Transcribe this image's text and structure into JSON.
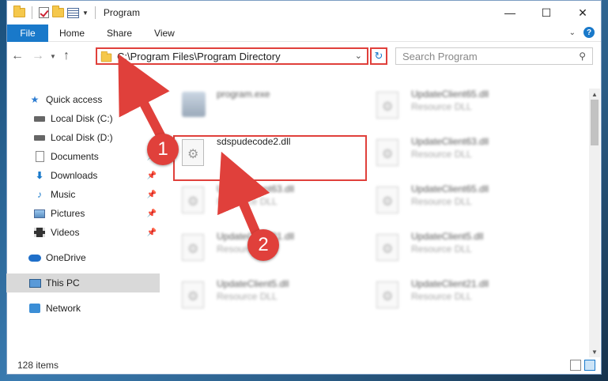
{
  "window": {
    "title": "Program"
  },
  "ribbon": {
    "file": "File",
    "tabs": [
      "Home",
      "Share",
      "View"
    ],
    "help": "?"
  },
  "address": {
    "path": "C:\\Program Files\\Program Directory"
  },
  "search": {
    "placeholder": "Search Program"
  },
  "sidebar": {
    "items": [
      {
        "label": "Quick access",
        "icon": "star-icon"
      },
      {
        "label": "Local Disk (C:)",
        "icon": "drive-icon"
      },
      {
        "label": "Local Disk (D:)",
        "icon": "drive-icon"
      },
      {
        "label": "Documents",
        "icon": "documents-icon"
      },
      {
        "label": "Downloads",
        "icon": "downloads-icon"
      },
      {
        "label": "Music",
        "icon": "music-icon"
      },
      {
        "label": "Pictures",
        "icon": "pictures-icon"
      },
      {
        "label": "Videos",
        "icon": "videos-icon"
      },
      {
        "label": "OneDrive",
        "icon": "cloud-icon"
      },
      {
        "label": "This PC",
        "icon": "computer-icon"
      },
      {
        "label": "Network",
        "icon": "network-icon"
      }
    ]
  },
  "files": [
    {
      "name": "program.exe",
      "type": ""
    },
    {
      "name": "UpdateClient65.dll",
      "type": "Resource DLL"
    },
    {
      "name": "sdspudecode2.dll",
      "type": ""
    },
    {
      "name": "UpdateClient63.dll",
      "type": "Resource DLL"
    },
    {
      "name": "UpdateClient63.dll",
      "type": "Resource DLL"
    },
    {
      "name": "UpdateClient65.dll",
      "type": "Resource DLL"
    },
    {
      "name": "UpdateClient21.dll",
      "type": "Resource DLL"
    },
    {
      "name": "UpdateClient5.dll",
      "type": "Resource DLL"
    },
    {
      "name": "UpdateClient5.dll",
      "type": "Resource DLL"
    },
    {
      "name": "UpdateClient21.dll",
      "type": "Resource DLL"
    }
  ],
  "status": {
    "count": "128 items"
  },
  "annotations": {
    "step1": "1",
    "step2": "2",
    "color": "#e0403b"
  }
}
